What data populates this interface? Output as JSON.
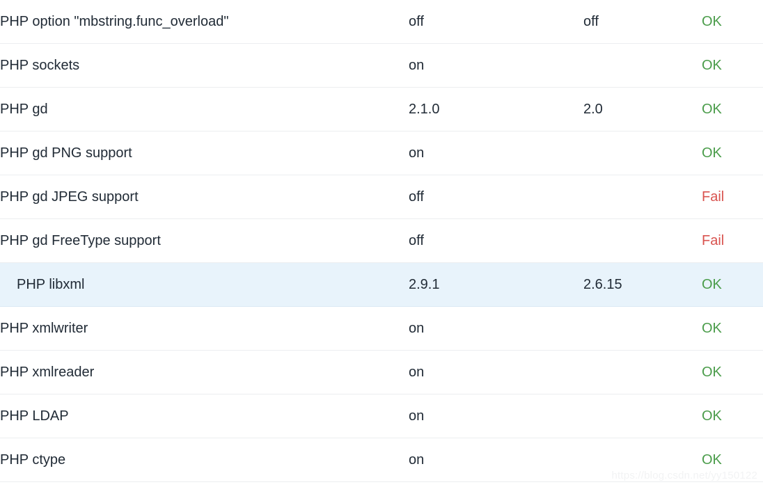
{
  "table": {
    "rows": [
      {
        "name": "PHP option \"mbstring.func_overload\"",
        "current": "off",
        "required": "off",
        "status": "OK",
        "status_kind": "ok",
        "highlighted": false
      },
      {
        "name": "PHP sockets",
        "current": "on",
        "required": "",
        "status": "OK",
        "status_kind": "ok",
        "highlighted": false
      },
      {
        "name": "PHP gd",
        "current": "2.1.0",
        "required": "2.0",
        "status": "OK",
        "status_kind": "ok",
        "highlighted": false
      },
      {
        "name": "PHP gd PNG support",
        "current": "on",
        "required": "",
        "status": "OK",
        "status_kind": "ok",
        "highlighted": false
      },
      {
        "name": "PHP gd JPEG support",
        "current": "off",
        "required": "",
        "status": "Fail",
        "status_kind": "fail",
        "highlighted": false
      },
      {
        "name": "PHP gd FreeType support",
        "current": "off",
        "required": "",
        "status": "Fail",
        "status_kind": "fail",
        "highlighted": false
      },
      {
        "name": "PHP libxml",
        "current": "2.9.1",
        "required": "2.6.15",
        "status": "OK",
        "status_kind": "ok",
        "highlighted": true
      },
      {
        "name": "PHP xmlwriter",
        "current": "on",
        "required": "",
        "status": "OK",
        "status_kind": "ok",
        "highlighted": false
      },
      {
        "name": "PHP xmlreader",
        "current": "on",
        "required": "",
        "status": "OK",
        "status_kind": "ok",
        "highlighted": false
      },
      {
        "name": "PHP LDAP",
        "current": "on",
        "required": "",
        "status": "OK",
        "status_kind": "ok",
        "highlighted": false
      },
      {
        "name": "PHP ctype",
        "current": "on",
        "required": "",
        "status": "OK",
        "status_kind": "ok",
        "highlighted": false
      }
    ]
  },
  "watermark": {
    "text": "https://blog.csdn.net/yy150122"
  },
  "colors": {
    "ok": "#4a9c4a",
    "fail": "#d9534f",
    "text": "#212b36",
    "row_highlight": "#e8f3fb",
    "divider": "#eceef0",
    "watermark": "#f2f3f4"
  }
}
